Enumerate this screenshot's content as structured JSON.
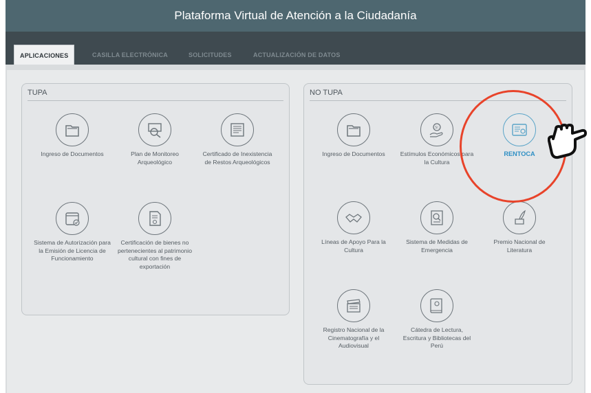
{
  "header": {
    "title": "Plataforma Virtual de Atención a la Ciudadanía"
  },
  "tabs": [
    {
      "label": "APLICACIONES",
      "active": true
    },
    {
      "label": "CASILLA ELECTRÓNICA",
      "active": false
    },
    {
      "label": "SOLICITUDES",
      "active": false
    },
    {
      "label": "ACTUALIZACIÓN DE DATOS",
      "active": false
    }
  ],
  "tupa": {
    "title": "TUPA",
    "apps": [
      {
        "label": "Ingreso de Documentos",
        "icon": "folder-icon"
      },
      {
        "label": "Plan de Monitoreo Arqueológico",
        "icon": "magnifier-monitor-icon"
      },
      {
        "label": "Certificado de Inexistencia de Restos Arqueológicos",
        "icon": "certificate-document-icon"
      },
      {
        "label": "Sistema de Autorización para la Emisión de Licencia de Funcionamiento",
        "icon": "calendar-check-icon"
      },
      {
        "label": "Certificación de bienes no pertenecientes al patrimonio cultural con fines de exportación",
        "icon": "document-seal-icon"
      }
    ]
  },
  "notupa": {
    "title": "NO TUPA",
    "apps": [
      {
        "label": "Ingreso de Documentos",
        "icon": "folder-icon"
      },
      {
        "label": "Estímulos Económicos para la Cultura",
        "icon": "money-hand-icon",
        "badge": "S/."
      },
      {
        "label": "RENTOCA",
        "icon": "certificate-id-icon"
      },
      {
        "label": "Líneas de Apoyo Para la Cultura",
        "icon": "handshake-icon"
      },
      {
        "label": "Sistema de Medidas de Emergencia",
        "icon": "emergency-search-icon"
      },
      {
        "label": "Premio Nacional de Literatura",
        "icon": "ink-quill-icon"
      },
      {
        "label": "Registro Nacional de la Cinematografía y el Audiovisual",
        "icon": "clapperboard-icon"
      },
      {
        "label": "Cátedra de Lectura, Escritura y Bibliotecas del Perú",
        "icon": "book-icon"
      }
    ]
  },
  "colors": {
    "highlight_circle": "#e8432a",
    "rentoca_accent": "#2e8fc4",
    "header_bg": "#4e6770"
  }
}
